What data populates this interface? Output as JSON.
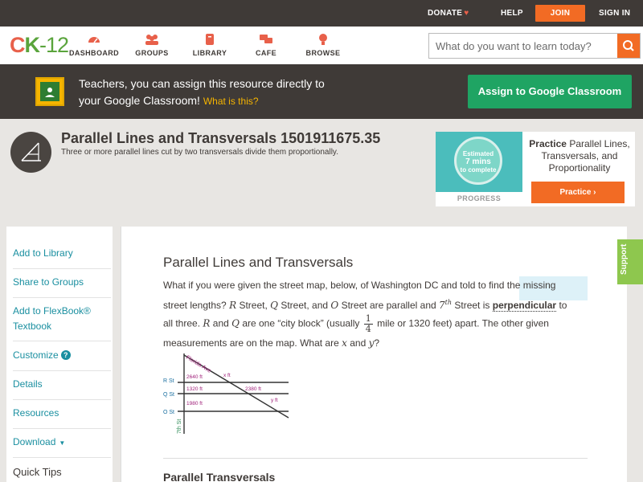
{
  "topbar": {
    "donate": "DONATE",
    "help": "HELP",
    "join": "JOIN",
    "signin": "SIGN IN"
  },
  "nav": {
    "logo_c": "C",
    "logo_k": "K",
    "logo_rest": "-12",
    "items": [
      {
        "label": "DASHBOARD",
        "icon": "dashboard-icon"
      },
      {
        "label": "GROUPS",
        "icon": "groups-icon"
      },
      {
        "label": "LIBRARY",
        "icon": "library-icon"
      },
      {
        "label": "CAFE",
        "icon": "cafe-icon"
      },
      {
        "label": "BROWSE",
        "icon": "browse-icon"
      }
    ],
    "search_placeholder": "What do you want to learn today?"
  },
  "banner": {
    "line1": "Teachers, you can assign this resource directly to",
    "line2": "your Google Classroom!",
    "what_link": "What is this?",
    "assign_button": "Assign to Google Classroom"
  },
  "concept": {
    "title": "Parallel Lines and Transversals 1501911675.35",
    "subtitle": "Three or more parallel lines cut by two transversals divide them proportionally."
  },
  "practice": {
    "ring_top": "Estimated",
    "ring_mid": "7 mins",
    "ring_bottom": "to complete",
    "progress_label": "PROGRESS",
    "practice_word": "Practice",
    "practice_desc": "Parallel Lines, Transversals, and Proportionality",
    "button": "Practice"
  },
  "sidemenu": {
    "add_library": "Add to Library",
    "share_groups": "Share to Groups",
    "add_flexbook_1": "Add to FlexBook®",
    "add_flexbook_2": "Textbook",
    "customize": "Customize",
    "details": "Details",
    "resources": "Resources",
    "download": "Download",
    "quick_tips": "Quick Tips"
  },
  "content": {
    "heading": "Parallel Lines and Transversals",
    "p1": "What if you were given the street map, below, of Washington DC and told to find the missing",
    "p2a": "street lengths?",
    "var_r": "R",
    "p2b": "Street,",
    "var_q": "Q",
    "p2c": "Street, and",
    "var_o": "O",
    "p2d": "Street are parallel and",
    "var_7": "7",
    "var_th": "th",
    "p2e": "Street is",
    "perp": "perpendicular",
    "p2f": "to",
    "p3a": "all three.",
    "var_r2": "R",
    "p3b": "and",
    "var_q2": "Q",
    "p3c": "are one “city block” (usually",
    "frac_num": "1",
    "frac_den": "4",
    "p3d": "mile or 1320 feet) apart. The other given",
    "p4a": "measurements are on the map. What are",
    "var_x": "x",
    "p4b": "and",
    "var_y": "y",
    "p4c": "?",
    "subheading": "Parallel Transversals"
  },
  "diagram": {
    "florida": "Florida Ave",
    "r_st": "R St",
    "q_st": "Q St",
    "o_st": "O St",
    "seventh": "7th St",
    "d2640": "2640 ft",
    "d1320": "1320 ft",
    "d1980": "1980 ft",
    "d2380": "2380 ft",
    "dx": "x ft",
    "dy": "y ft"
  },
  "support": "Support",
  "colors": {
    "accent_orange": "#f26b24",
    "link_teal": "#1a8fa0",
    "classroom_green": "#1fa463",
    "dark_bar": "#3f3a37",
    "support_green": "#8ec74e"
  }
}
